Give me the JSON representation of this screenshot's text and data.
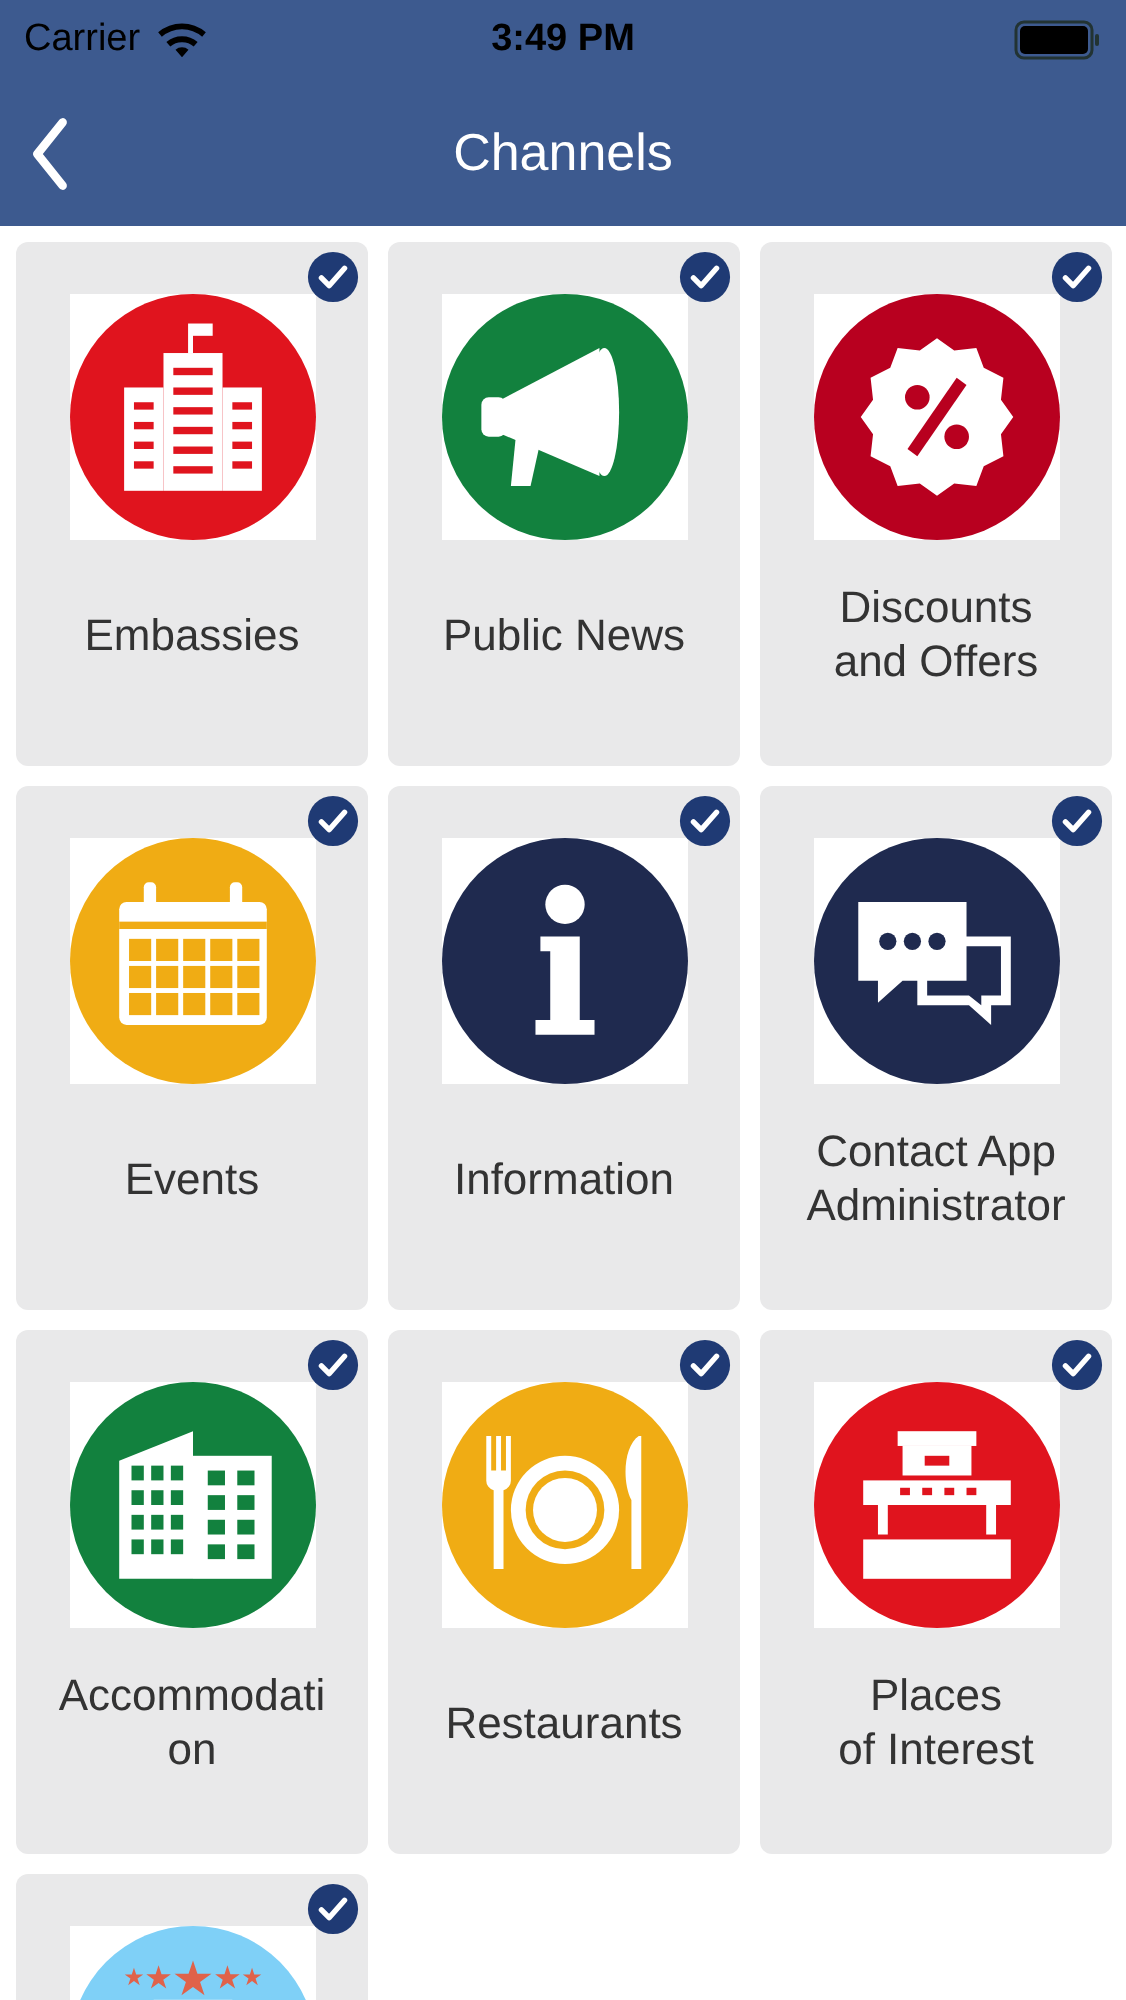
{
  "status_bar": {
    "carrier": "Carrier",
    "time": "3:49 PM"
  },
  "nav": {
    "title": "Channels"
  },
  "channels": [
    {
      "label": "Embassies",
      "kind": "building",
      "color": "#e0141e",
      "selected": true
    },
    {
      "label": "Public News",
      "kind": "megaphone",
      "color": "#12813e",
      "selected": true
    },
    {
      "label": "Discounts\nand Offers",
      "kind": "percent",
      "color": "#b8001f",
      "selected": true
    },
    {
      "label": "Events",
      "kind": "calendar",
      "color": "#f0ac14",
      "selected": true
    },
    {
      "label": "Information",
      "kind": "info",
      "color": "#1f2a4f",
      "selected": true
    },
    {
      "label": "Contact App\nAdministrator",
      "kind": "chat",
      "color": "#1f2a4f",
      "selected": true
    },
    {
      "label": "Accommodati\non",
      "kind": "office",
      "color": "#12813e",
      "selected": true
    },
    {
      "label": "Restaurants",
      "kind": "dining",
      "color": "#f0ac14",
      "selected": true
    },
    {
      "label": "Places\nof Interest",
      "kind": "pier",
      "color": "#e0141e",
      "selected": true
    },
    {
      "kind": "stars",
      "color": "#7fd0f7",
      "selected": true
    }
  ]
}
